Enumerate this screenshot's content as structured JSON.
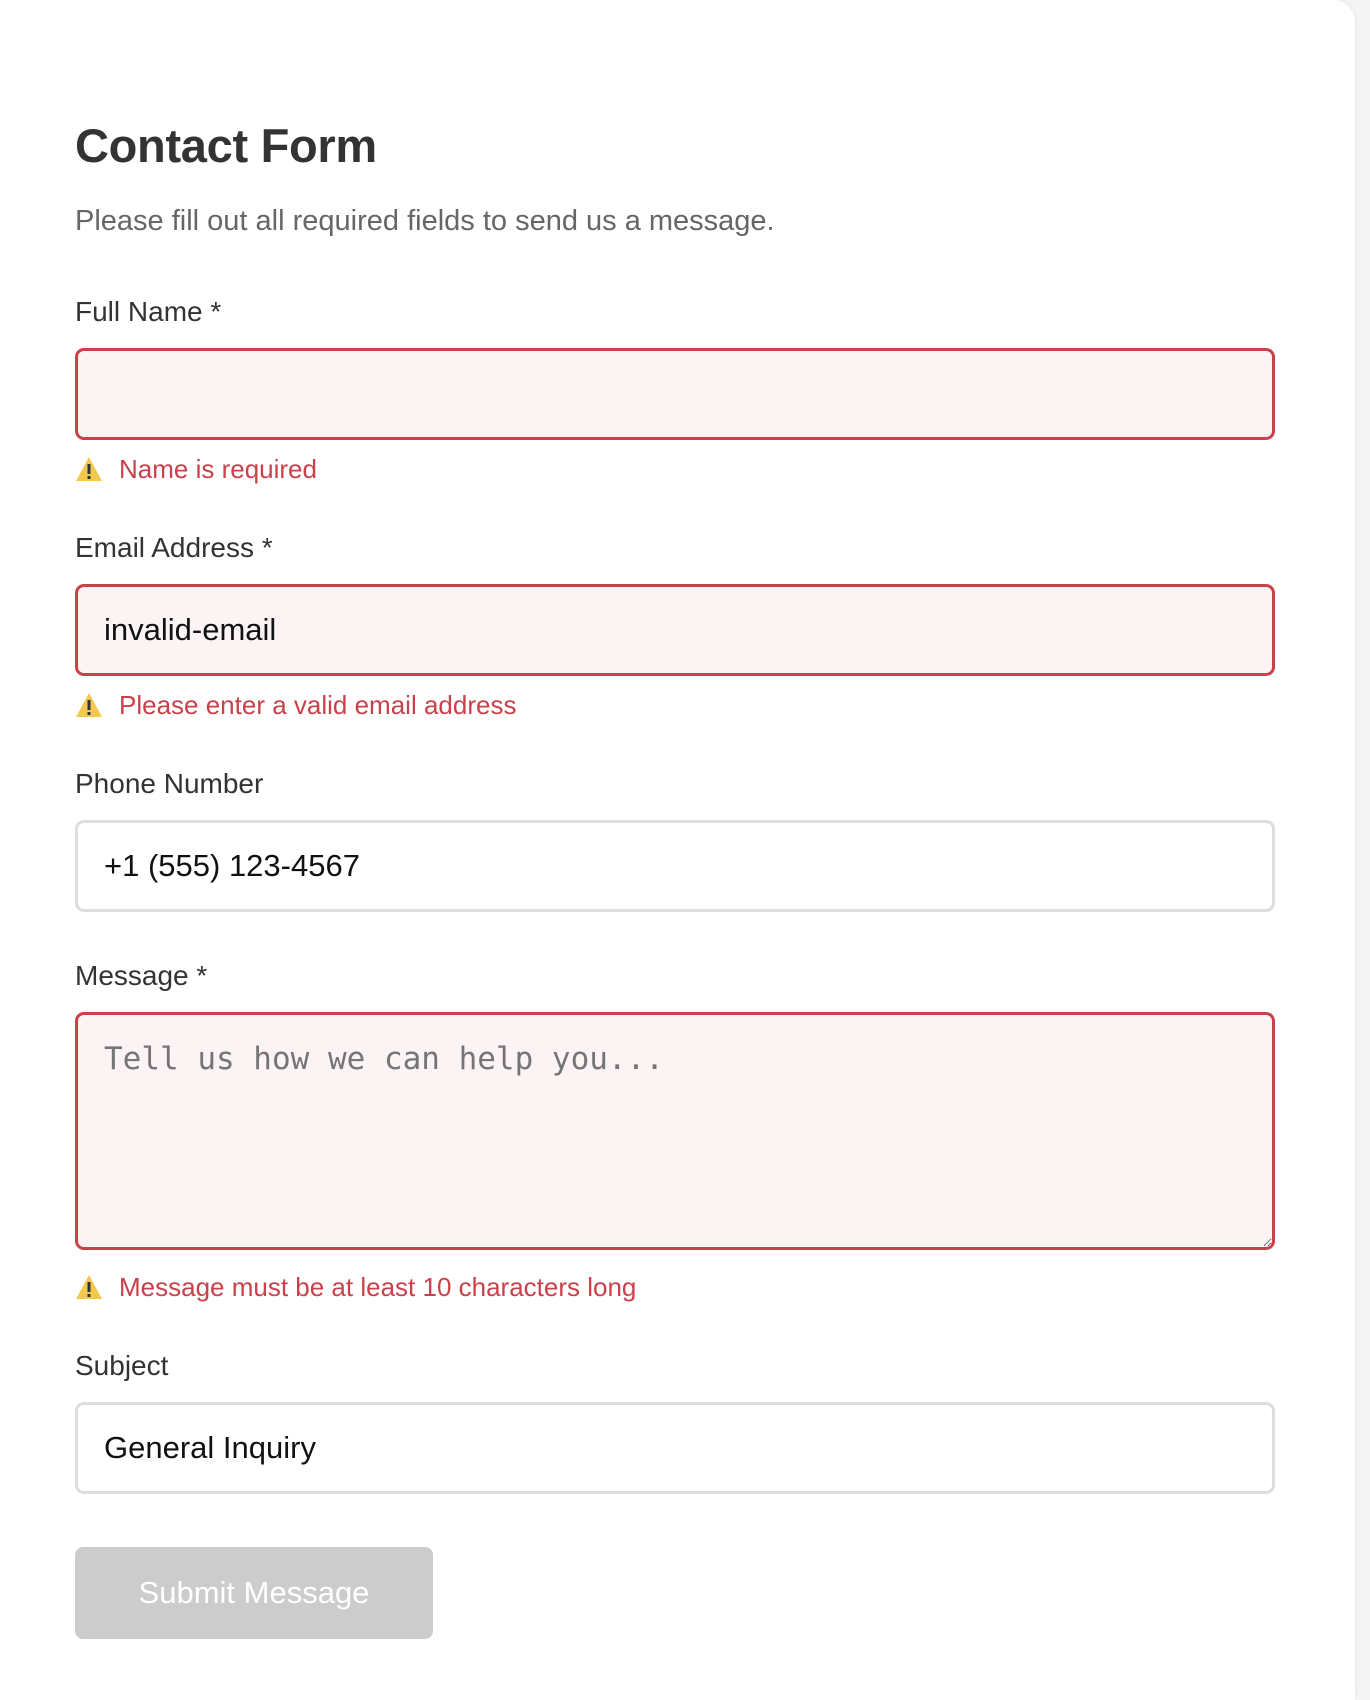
{
  "form": {
    "title": "Contact Form",
    "subtitle": "Please fill out all required fields to send us a message.",
    "submit_label": "Submit Message",
    "fields": {
      "name": {
        "label": "Full Name *",
        "value": "",
        "error": "Name is required"
      },
      "email": {
        "label": "Email Address *",
        "value": "invalid-email",
        "error": "Please enter a valid email address"
      },
      "phone": {
        "label": "Phone Number",
        "value": "+1 (555) 123-4567"
      },
      "message": {
        "label": "Message *",
        "value": "",
        "placeholder": "Tell us how we can help you...",
        "error": "Message must be at least 10 characters long"
      },
      "subject": {
        "label": "Subject",
        "value": "General Inquiry"
      }
    }
  },
  "colors": {
    "error": "#c9414b",
    "error_background": "#fcf4f4",
    "warning_icon": "#f2c94c",
    "disabled_button": "#cccccc"
  },
  "icons": {
    "warning": "warning-icon"
  }
}
